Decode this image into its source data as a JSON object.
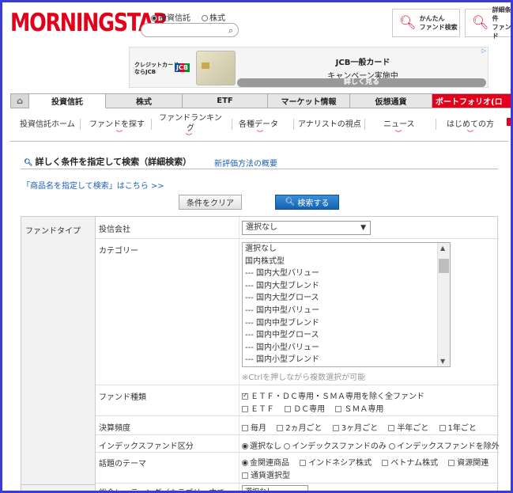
{
  "header": {
    "logo": "MORNINGSTAR",
    "radio_fund": "投資信託",
    "radio_stock": "株式",
    "search_placeholder": "",
    "btn_easy_search": "かんたん\nファンド検索",
    "btn_detailed_search": "詳細条件\nファンド"
  },
  "ad": {
    "brand": "クレジットカード\nならJCB",
    "jcb_logo": "JCB",
    "title": "JCB一般カード",
    "subtitle": "キャンペーン実施中",
    "cta": "詳しく見る"
  },
  "main_tabs": [
    {
      "label": "投資信託"
    },
    {
      "label": "株式"
    },
    {
      "label": "ETF"
    },
    {
      "label": "マーケット情報"
    },
    {
      "label": "仮想通貨"
    },
    {
      "label": "ポートフォリオ(ロ"
    }
  ],
  "sub_nav": [
    {
      "label": "投資信託ホーム"
    },
    {
      "label": "ファンドを探す"
    },
    {
      "label": "ファンドランキン\nグ"
    },
    {
      "label": "各種データ"
    },
    {
      "label": "アナリストの視点"
    },
    {
      "label": "ニュース"
    },
    {
      "label": "はじめての方"
    }
  ],
  "section": {
    "title": "詳しく条件を指定して検索（詳細検索）",
    "rating_link": "新評価方法の概要",
    "name_search_link": "「商品名を指定して検索」はこちら >>",
    "clear_button": "条件をクリア",
    "search_button": "検索する"
  },
  "form": {
    "fund_type_label": "ファンドタイプ",
    "company_label": "投信会社",
    "company_value": "選択なし",
    "category_label": "カテゴリー",
    "category_options": [
      "選択なし",
      "国内株式型",
      "--- 国内大型バリュー",
      "--- 国内大型ブレンド",
      "--- 国内大型グロース",
      "--- 国内中型バリュー",
      "--- 国内中型ブレンド",
      "--- 国内中型グロース",
      "--- 国内小型バリュー",
      "--- 国内小型ブレンド"
    ],
    "ctrl_note": "※Ctrlを押しながら複数選択が可能",
    "fund_kind_label": "ファンド種類",
    "fund_kind_all": "ＥＴＦ・ＤＣ専用・ＳＭＡ専用を除く全ファンド",
    "fund_kind_etf": "ＥＴＦ",
    "fund_kind_dc": "ＤＣ専用",
    "fund_kind_sma": "ＳＭＡ専用",
    "settlement_label": "決算頻度",
    "settlement_options": [
      "毎月",
      "2ヵ月ごと",
      "3ヶ月ごと",
      "半年ごと",
      "1年ごと"
    ],
    "index_label": "インデックスファンド区分",
    "index_options": [
      "選択なし",
      "インデックスファンドのみ",
      "インデックスファンドを除外"
    ],
    "theme_label": "話題のテーマ",
    "theme_options": [
      "金関連商品",
      "インドネシア株式",
      "ベトナム株式",
      "資源関連",
      "通貨選択型"
    ],
    "rating_label_cut": "総合レーティング（カテゴリー内で",
    "rating_value_cut": "選択なし"
  },
  "colors": {
    "brand_red": "#e2001a",
    "link_blue": "#1a5fb4",
    "frame_blue": "#3b3bd6"
  }
}
